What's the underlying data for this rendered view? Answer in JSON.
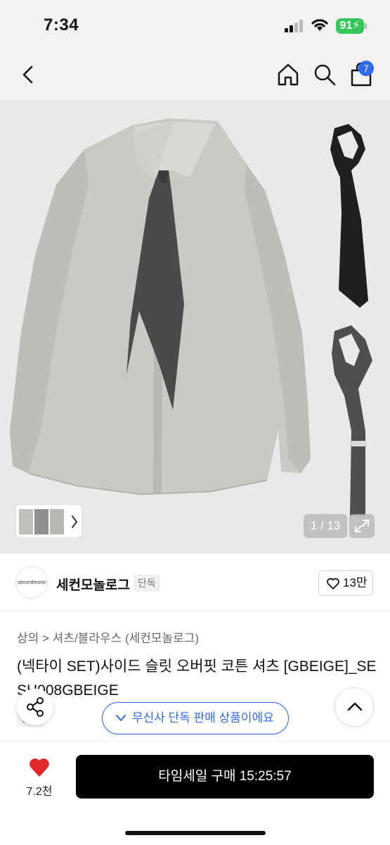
{
  "status_bar": {
    "time": "7:34",
    "battery": "91"
  },
  "nav": {
    "back_icon": "chevron-left-icon",
    "home_icon": "home-icon",
    "search_icon": "search-icon",
    "cart_icon": "shopping-bag-icon",
    "cart_count": "7"
  },
  "gallery": {
    "counter": "1 / 13",
    "expand_icon": "expand-icon"
  },
  "brand": {
    "logo_text": "secondmono",
    "name": "세컨모놀로그",
    "tag": "단독",
    "like_count": "13만"
  },
  "product": {
    "breadcrumb": [
      "상의",
      "셔츠/블라우스 (세컨모놀로그)"
    ],
    "title": "(넥타이 SET)사이드 슬릿 오버핏 코튼 셔츠 [GBEIGE]_SESH008GBEIGE",
    "exclusive_tag": "단독",
    "exclusive_notice": "무신사 단독 판매 상품이에요"
  },
  "footer": {
    "like_count": "7.2천",
    "buy_label": "타임세일 구매 15:25:57"
  },
  "colors": {
    "accent": "#2f6bea",
    "heart": "#e1262c",
    "battery": "#35c759",
    "buy_button": "#000000"
  }
}
